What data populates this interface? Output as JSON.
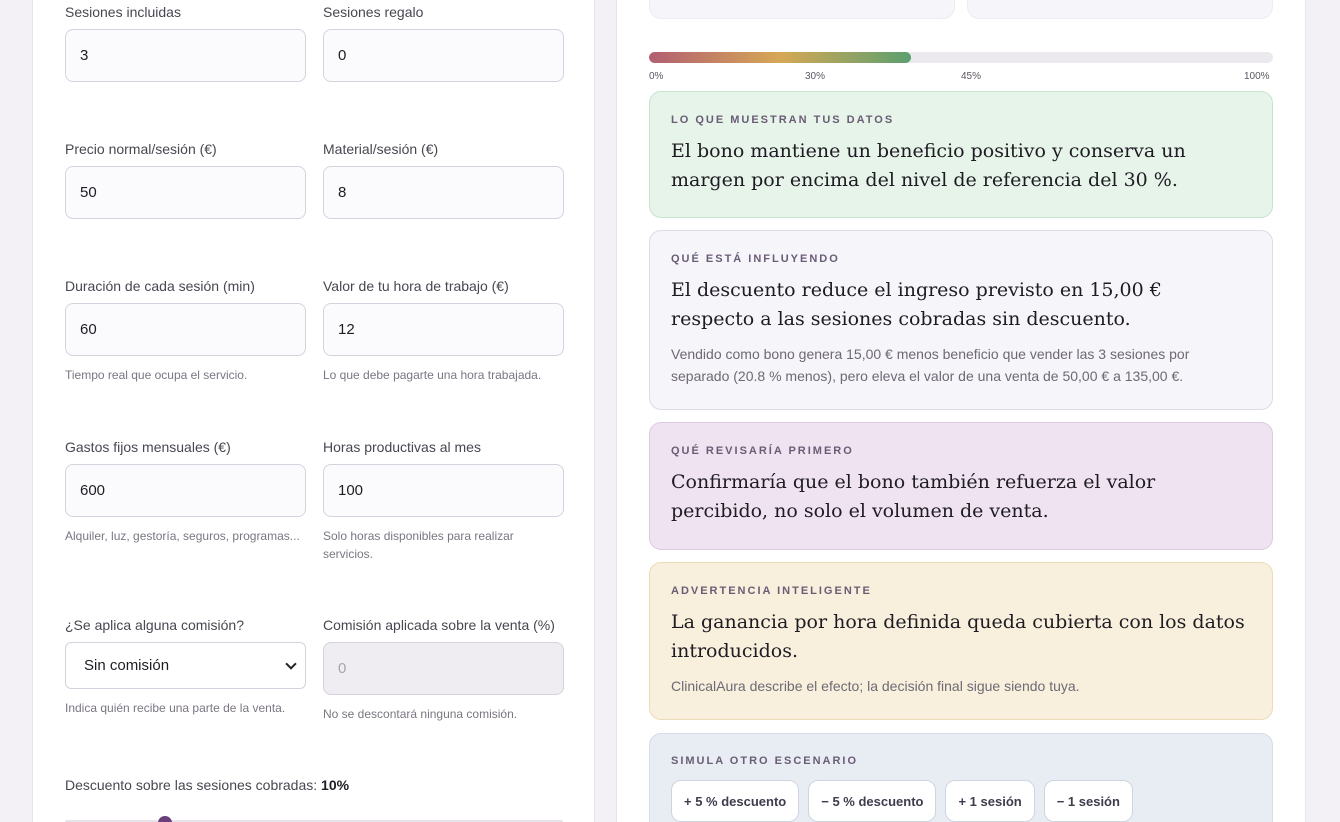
{
  "form": {
    "sessions_included": {
      "label": "Sesiones incluidas",
      "value": "3"
    },
    "gift_sessions": {
      "label": "Sesiones regalo",
      "value": "0"
    },
    "normal_price": {
      "label": "Precio normal/sesión (€)",
      "value": "50"
    },
    "material": {
      "label": "Material/sesión (€)",
      "value": "8"
    },
    "duration": {
      "label": "Duración de cada sesión (min)",
      "value": "60",
      "hint": "Tiempo real que ocupa el servicio."
    },
    "hour_value": {
      "label": "Valor de tu hora de trabajo (€)",
      "value": "12",
      "hint": "Lo que debe pagarte una hora trabajada."
    },
    "fixed_costs": {
      "label": "Gastos fijos mensuales (€)",
      "value": "600",
      "hint": "Alquiler, luz, gestoría, seguros, programas..."
    },
    "productive_hours": {
      "label": "Horas productivas al mes",
      "value": "100",
      "hint": "Solo horas disponibles para realizar servicios."
    },
    "commission_type": {
      "label": "¿Se aplica alguna comisión?",
      "value": "Sin comisión",
      "hint": "Indica quién recibe una parte de la venta."
    },
    "commission_pct": {
      "label": "Comisión aplicada sobre la venta (%)",
      "placeholder": "0",
      "hint": "No se descontará ninguna comisión."
    },
    "discount": {
      "label": "Descuento sobre las sesiones cobradas:",
      "value": "10%",
      "fraction": 0.1
    }
  },
  "margin_bar": {
    "value_pct": 42,
    "ticks": [
      "0%",
      "30%",
      "45%",
      "100%"
    ]
  },
  "cards": {
    "data": {
      "kicker": "Lo que muestran tus datos",
      "text": "El bono mantiene un beneficio positivo y conserva un margen por encima del nivel de referencia del 30 %."
    },
    "influence": {
      "kicker": "Qué está influyendo",
      "text": "El descuento reduce el ingreso previsto en 15,00 € respecto a las sesiones cobradas sin descuento.",
      "sub": "Vendido como bono genera 15,00 € menos beneficio que vender las 3 sesiones por separado (20.8 % menos), pero eleva el valor de una venta de 50,00 € a 135,00 €."
    },
    "review": {
      "kicker": "Qué revisaría primero",
      "text": "Confirmaría que el bono también refuerza el valor percibido, no solo el volumen de venta."
    },
    "warning": {
      "kicker": "Advertencia inteligente",
      "text": "La ganancia por hora definida queda cubierta con los datos introducidos.",
      "sub": "ClinicalAura describe el efecto; la decisión final sigue siendo tuya."
    },
    "simulate": {
      "kicker": "Simula otro escenario",
      "buttons": [
        "+ 5 % descuento",
        "− 5 % descuento",
        "+ 1 sesión",
        "− 1 sesión"
      ]
    }
  }
}
